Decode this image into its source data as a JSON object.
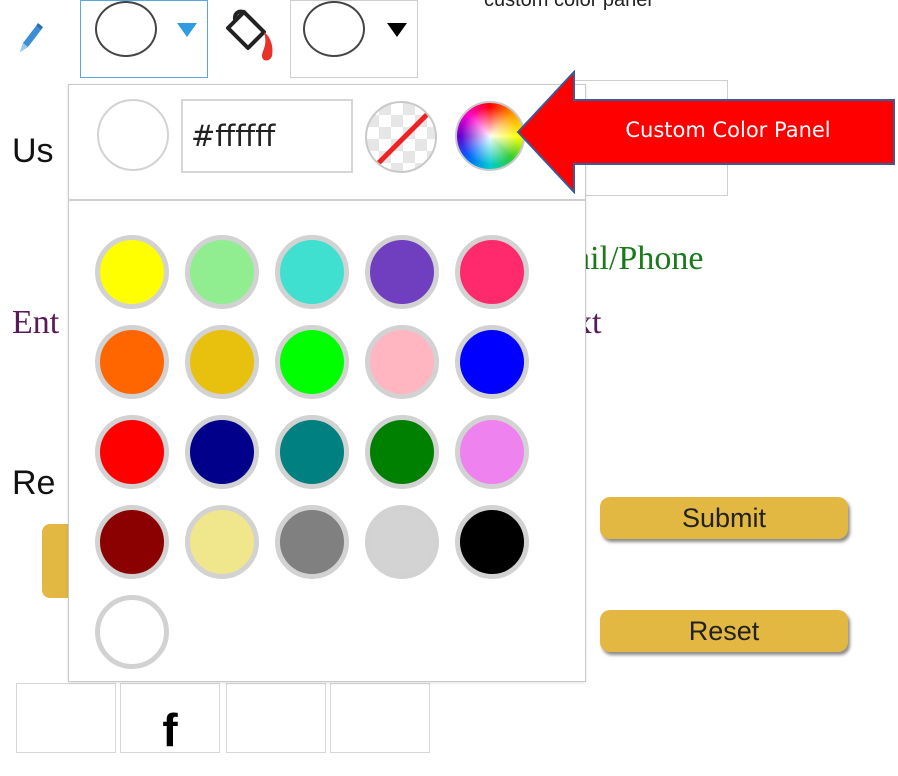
{
  "top_caption": "custom color panel",
  "toolbar": {
    "pencil_icon": "pencil-icon",
    "border_color_caret_color": "#2f9be0",
    "fill_bucket_icon": "paint-bucket-icon",
    "fill_color_caret_color": "#000000"
  },
  "background_form": {
    "user_label": "Us",
    "email_label": "ail/Phone",
    "enter_label": "Ent",
    "text_label": "xt",
    "res_label": "Re",
    "submit_label": "Submit",
    "reset_label": "Reset",
    "bottom_cell_text": "f"
  },
  "color_panel": {
    "current_color": "#ffffff",
    "hex_value": "#ffffff",
    "no_color_icon": "no-color-icon",
    "custom_color_icon": "color-wheel-icon",
    "swatches": [
      "#ffff00",
      "#90ee90",
      "#40e0d0",
      "#6f3fbf",
      "#ff2a6d",
      "#ff6600",
      "#e8c00e",
      "#00ff00",
      "#ffb6c1",
      "#0000ff",
      "#ff0000",
      "#00008b",
      "#008080",
      "#008000",
      "#ee82ee",
      "#8b0000",
      "#f0e68c",
      "#808080",
      "#d3d3d3",
      "#000000",
      "#ffffff"
    ]
  },
  "annotation": {
    "label": "Custom Color Panel",
    "arrow_color": "#ff0000"
  }
}
